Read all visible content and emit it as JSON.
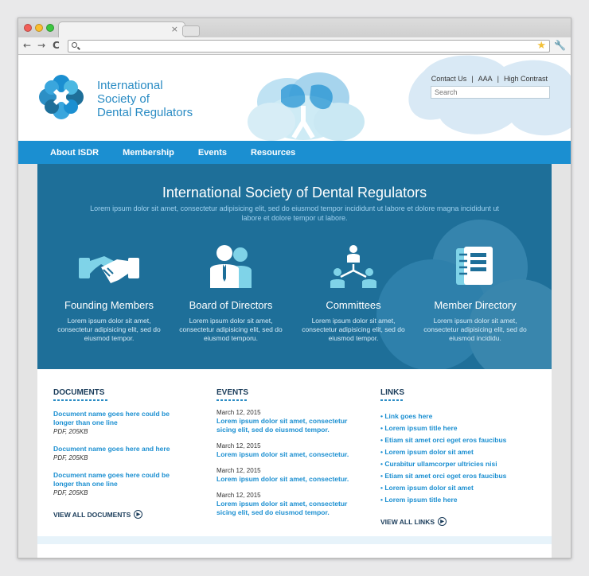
{
  "browser": {
    "tab_close": "×",
    "back": "←",
    "forward": "→",
    "reload": "C",
    "url": ""
  },
  "header": {
    "logo_lines": [
      "International",
      "Society of",
      "Dental Regulators"
    ],
    "utility": {
      "contact": "Contact Us",
      "sep": "|",
      "text_size": "AAA",
      "high_contrast": "High Contrast"
    },
    "search_placeholder": "Search"
  },
  "nav": [
    "About ISDR",
    "Membership",
    "Events",
    "Resources"
  ],
  "hero": {
    "title": "International Society of Dental Regulators",
    "subtitle": "Lorem ipsum dolor sit amet, consectetur adipisicing elit, sed do eiusmod tempor incididunt ut labore et dolore magna incididunt ut labore et dolore tempor ut labore.",
    "features": [
      {
        "title": "Founding Members",
        "text": "Lorem ipsum dolor sit amet, consectetur adipisicing elit, sed do eiusmod tempor.",
        "icon": "handshake-icon"
      },
      {
        "title": "Board of Directors",
        "text": "Lorem ipsum dolor sit amet, consectetur adipisicing elit, sed do eiusmod temporu.",
        "icon": "directors-icon"
      },
      {
        "title": "Committees",
        "text": "Lorem ipsum dolor sit amet, consectetur adipisicing elit, sed do eiusmod tempor.",
        "icon": "committees-icon"
      },
      {
        "title": "Member Directory",
        "text": "Lorem ipsum dolor sit amet, consectetur adipisicing elit, sed do eiusmod incididu.",
        "icon": "directory-icon"
      }
    ]
  },
  "documents": {
    "heading": "DOCUMENTS",
    "items": [
      {
        "title": "Document name goes here could be longer than one line",
        "meta": "PDF, 205KB"
      },
      {
        "title": "Document name goes here and here",
        "meta": "PDF, 205KB"
      },
      {
        "title": "Document name goes here could be longer than one line",
        "meta": "PDF, 205KB"
      }
    ],
    "view_all": "VIEW ALL DOCUMENTS"
  },
  "events": {
    "heading": "EVENTS",
    "items": [
      {
        "date": "March 12, 2015",
        "title": "Lorem ipsum dolor sit amet, consectetur sicing elit, sed do eiusmod tempor."
      },
      {
        "date": "March 12, 2015",
        "title": "Lorem ipsum dolor sit amet, consectetur."
      },
      {
        "date": "March 12, 2015",
        "title": "Lorem ipsum dolor sit amet, consectetur."
      },
      {
        "date": "March 12, 2015",
        "title": "Lorem ipsum dolor sit amet, consectetur sicing elit, sed do eiusmod tempor."
      }
    ]
  },
  "links": {
    "heading": "LINKS",
    "items": [
      "• Link goes here",
      "• Lorem ipsum title here",
      "• Etiam sit amet orci eget eros faucibus",
      "• Lorem ipsum dolor sit amet",
      "• Curabitur ullamcorper ultricies nisi",
      "• Etiam sit amet orci eget eros faucibus",
      "• Lorem ipsum dolor sit amet",
      "• Lorem ipsum title here"
    ],
    "view_all": "VIEW ALL LINKS"
  },
  "colors": {
    "brand_blue": "#1b8fd1",
    "hero_bg": "#1e6f99",
    "heading_navy": "#1a3c5a"
  }
}
